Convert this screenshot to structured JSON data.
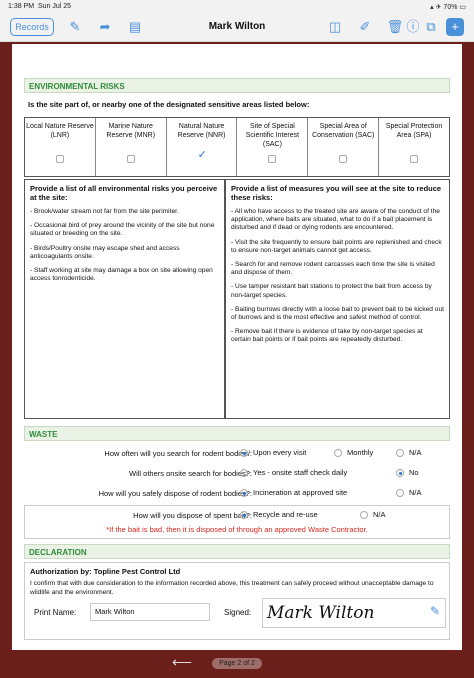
{
  "status": {
    "time": "1:38 PM",
    "date": "Sun Jul 25",
    "battery": "70%"
  },
  "toolbar": {
    "records_label": "Records",
    "title": "Mark Wilton"
  },
  "icons": {
    "draw": "brush-icon",
    "share": "share-icon",
    "doc": "document-icon",
    "file": "file-icon",
    "pen": "pen-icon",
    "trash": "trash-icon",
    "info": "info-icon",
    "copy": "copy-icon",
    "add": "add-icon"
  },
  "environmental": {
    "heading": "ENVIRONMENTAL RISKS",
    "question": "Is the site part of, or nearby one of the designated sensitive areas listed below:",
    "areas": [
      {
        "label": "Local Nature Reserve (LNR)",
        "checked": false
      },
      {
        "label": "Marine Nature Reserve (MNR)",
        "checked": false
      },
      {
        "label": "Natural Nature Reserve (NNR)",
        "checked": true
      },
      {
        "label": "Site of Special Scientific Interest (SAC)",
        "checked": false
      },
      {
        "label": "Special Area of Conservation (SAC)",
        "checked": false
      },
      {
        "label": "Special Protection Area (SPA)",
        "checked": false
      }
    ],
    "risks_title": "Provide a list of all environmental risks you perceive at the site:",
    "risks": [
      "- Brook/water stream not far from the site perimiter.",
      "- Occasional bird of prey around the vicinity of the site but none situated or breeding on the site.",
      "- Birds/Poultry onsite may escape shed and access anticoagulants onsite.",
      "- Staff working at site may damage a box on site allowing open access tonrodenticide."
    ],
    "measures_title": "Provide a list of measures you will see at the site to reduce these risks:",
    "measures": [
      "- All who have access to the treated site are aware of the conduct of the application, where baits are situated, what to do if a bait placement is disturbed and if dead or dying rodents are encountered.",
      "- Visit the site frequently to ensure bait points are replenished and check to ensure non-target animals cannot get access.",
      "- Search for and remove rodent carcasses each time the site is visited and dispose of them.",
      "- Use tamper resistant bait stations to protect the bait from access by non-target species.",
      "- Baiting burrows directly with a loose bait to prevent bait to be kicked out of burrows and is the most effective and safest method of control.",
      "- Remove bait if there is evidence of take by non-target species at certain bait points or if bait points are repeatedly disturbed."
    ]
  },
  "waste": {
    "heading": "WASTE",
    "q1": {
      "label": "How often will you search for rodent bodies/:",
      "opt1": "Upon every visit",
      "opt2": "Monthly",
      "opt3": "N/A",
      "selected": 1
    },
    "q2": {
      "label": "Will others onsite search for bodies?:",
      "opt1": "Yes - onsite staff check daily",
      "opt2": "No",
      "selected": 2
    },
    "q3": {
      "label": "How will you safely dispose of rodent bodies?:",
      "opt1": "Incineration at approved site",
      "opt2": "N/A",
      "selected": 1
    },
    "q4": {
      "label": "How will you dispose of spent bait?:",
      "opt1": "Recycle and re-use",
      "opt2": "N/A",
      "selected": 1
    },
    "note": "*If the bait is bad, then it is disposed of through an approved Waste Contractor."
  },
  "declaration": {
    "heading": "DECLARATION",
    "auth": "Authorization by: Topline Pest Control Ltd",
    "statement": "I confirm that with due consideration to the information recorded above, this treatment can safely proceed without unacceptable damage to wildlife and the environment.",
    "print_label": "Print Name:",
    "print_value": "Mark Wilton",
    "signed_label": "Signed:",
    "signature": "Mark Wilton"
  },
  "pager": {
    "label": "Page 2 of 2"
  }
}
